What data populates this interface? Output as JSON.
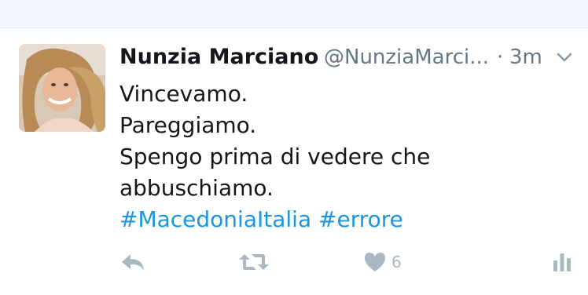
{
  "colors": {
    "background": "#f5f8fa",
    "card": "#ffffff",
    "name_text": "#14171a",
    "secondary_text": "#657786",
    "hashtag": "#1b95e0",
    "action_icon": "#aab8c2"
  },
  "tweet": {
    "author": {
      "display_name": "Nunzia Marciano",
      "handle": "@NunziaMarci..."
    },
    "separator": "·",
    "timestamp": "3m",
    "text_lines": [
      "Vincevamo.",
      "Pareggiamo.",
      "Spengo prima di vedere che",
      "abbuschiamo."
    ],
    "hashtags": [
      "#MacedoniaItalia",
      "#errore"
    ],
    "actions": {
      "reply_icon": "reply-icon",
      "retweet_icon": "retweet-icon",
      "like_icon": "heart-icon",
      "like_count": "6",
      "analytics_icon": "analytics-icon"
    }
  }
}
